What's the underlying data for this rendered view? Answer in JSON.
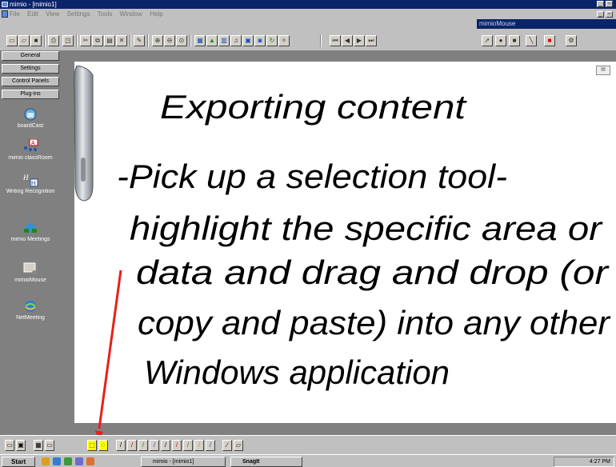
{
  "window": {
    "title": "mimio - [mimio1]"
  },
  "menu": [
    "File",
    "Edit",
    "View",
    "Settings",
    "Tools",
    "Window",
    "Help"
  ],
  "mimio_mouse_panel": {
    "title": "mimioMouse"
  },
  "sidebar": {
    "buttons": [
      "General",
      "Settings",
      "Control Panels",
      "Plug-ins"
    ],
    "plugins": [
      {
        "label": "boardCast",
        "icon": "boardcast-icon"
      },
      {
        "label": "mimio classRoom",
        "icon": "classroom-icon"
      },
      {
        "label": "Writing Recognition",
        "icon": "writing-recognition-icon"
      },
      {
        "label": "mimio Meetings",
        "icon": "meetings-icon"
      },
      {
        "label": "mimioMouse",
        "icon": "mimiomouse-icon"
      },
      {
        "label": "NetMeeting",
        "icon": "netmeeting-icon"
      }
    ]
  },
  "page": {
    "lines": [
      "Exporting content",
      "-Pick up a selection tool-",
      "highlight the specific area or",
      "data and drag and drop (or",
      "copy and paste) into any other",
      "Windows application"
    ]
  },
  "taskbar": {
    "start_label": "Start",
    "tasks": [
      "mimio - [mimio1]",
      "SnagIt"
    ],
    "clock": "4:27 PM"
  },
  "colors": {
    "titlebar": "#0a246a",
    "ink": "#000000",
    "arrow": "#e8201a",
    "highlight": "#ffff00"
  }
}
